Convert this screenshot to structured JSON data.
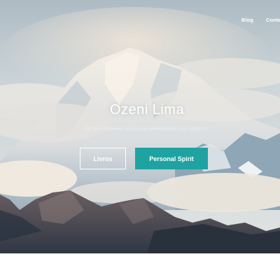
{
  "nav": {
    "items": [
      {
        "label": "Blog"
      },
      {
        "label": "Contato"
      }
    ]
  },
  "hero": {
    "title": "Ozeni Lima",
    "subtitle": "De que maneira você está alimentando seu espírito?",
    "buttons": [
      {
        "label": "Livros"
      },
      {
        "label": "Personal Spirit"
      }
    ]
  },
  "colors": {
    "accent": "#1ea3a2",
    "sky": "#c9d6df",
    "text_on_image": "#ffffff"
  }
}
